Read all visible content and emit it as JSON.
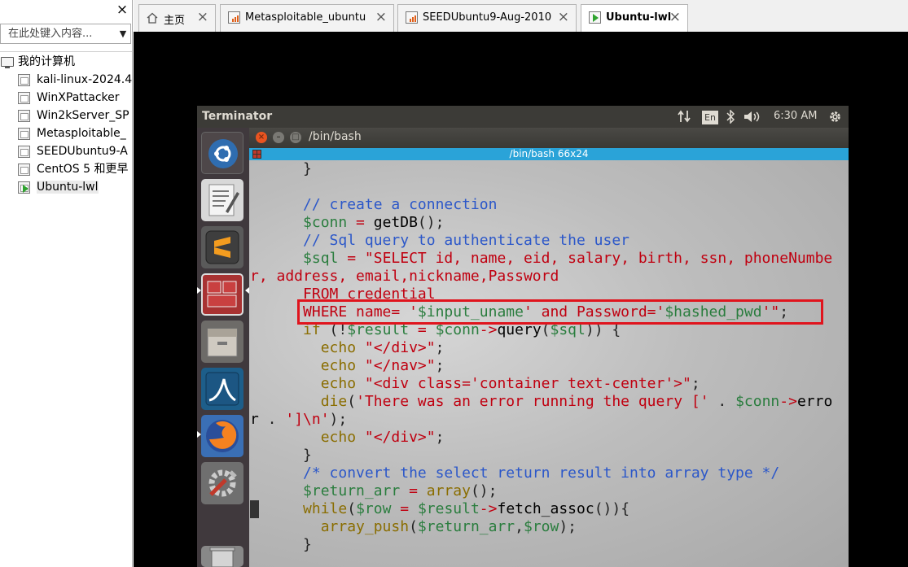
{
  "library": {
    "close_icon": "×",
    "search_placeholder": "在此处键入内容...",
    "dropdown_icon": "▼",
    "root": "我的计算机",
    "items": [
      {
        "label": "kali-linux-2024.4",
        "running": false
      },
      {
        "label": "WinXPattacker",
        "running": false
      },
      {
        "label": "Win2kServer_SP",
        "running": false
      },
      {
        "label": "Metasploitable_",
        "running": false
      },
      {
        "label": "SEEDUbuntu9-A",
        "running": false
      },
      {
        "label": "CentOS 5 和更早",
        "running": false
      },
      {
        "label": "Ubuntu-lwl",
        "running": true
      }
    ]
  },
  "tabs": [
    {
      "label": "主页",
      "icon": "home-icon"
    },
    {
      "label": "Metasploitable_ubuntu",
      "icon": "vm-icon"
    },
    {
      "label": "SEEDUbuntu9-Aug-2010",
      "icon": "vm-icon"
    },
    {
      "label": "Ubuntu-lwl",
      "icon": "vm-running-icon",
      "active": true
    }
  ],
  "tab_close": "×",
  "ubuntu_panel": {
    "app_title": "Terminator",
    "keyboard": "En",
    "time": "6:30 AM"
  },
  "terminal": {
    "window_title": "/bin/bash",
    "tab_title": "/bin/bash 66x24"
  },
  "code_lines": [
    [
      {
        "t": "      }",
        "c": "c-plain"
      }
    ],
    [],
    [
      {
        "t": "      // create a connection",
        "c": "c-cmt"
      }
    ],
    [
      {
        "t": "      $conn",
        "c": "c-var"
      },
      {
        "t": " = ",
        "c": "c-op"
      },
      {
        "t": "getDB",
        "c": "c-fn"
      },
      {
        "t": "();",
        "c": "c-plain"
      }
    ],
    [
      {
        "t": "      // Sql query to authenticate the user",
        "c": "c-cmt"
      }
    ],
    [
      {
        "t": "      $sql",
        "c": "c-var"
      },
      {
        "t": " = ",
        "c": "c-op"
      },
      {
        "t": "\"SELECT id, name, eid, salary, birth, ssn, phoneNumbe",
        "c": "c-str"
      }
    ],
    [
      {
        "t": "r, address, email,nickname,Password",
        "c": "c-str"
      }
    ],
    [
      {
        "t": "      FROM credential",
        "c": "c-str"
      }
    ],
    [
      {
        "t": "      WHERE name= '",
        "c": "c-str"
      },
      {
        "t": "$input_uname",
        "c": "c-var"
      },
      {
        "t": "' and Password='",
        "c": "c-str"
      },
      {
        "t": "$hashed_pwd",
        "c": "c-var"
      },
      {
        "t": "'\"",
        "c": "c-str"
      },
      {
        "t": ";",
        "c": "c-plain"
      }
    ],
    [
      {
        "t": "      if",
        "c": "c-kw"
      },
      {
        "t": " (!",
        "c": "c-plain"
      },
      {
        "t": "$result",
        "c": "c-var"
      },
      {
        "t": " = ",
        "c": "c-op"
      },
      {
        "t": "$conn",
        "c": "c-var"
      },
      {
        "t": "->",
        "c": "c-op"
      },
      {
        "t": "query",
        "c": "c-fn"
      },
      {
        "t": "(",
        "c": "c-plain"
      },
      {
        "t": "$sql",
        "c": "c-var"
      },
      {
        "t": ")) {",
        "c": "c-plain"
      }
    ],
    [
      {
        "t": "        echo",
        "c": "c-kw"
      },
      {
        "t": " \"</div>\"",
        "c": "c-str"
      },
      {
        "t": ";",
        "c": "c-plain"
      }
    ],
    [
      {
        "t": "        echo",
        "c": "c-kw"
      },
      {
        "t": " \"</nav>\"",
        "c": "c-str"
      },
      {
        "t": ";",
        "c": "c-plain"
      }
    ],
    [
      {
        "t": "        echo",
        "c": "c-kw"
      },
      {
        "t": " \"<div class='container text-center'>\"",
        "c": "c-str"
      },
      {
        "t": ";",
        "c": "c-plain"
      }
    ],
    [
      {
        "t": "        die",
        "c": "c-kw"
      },
      {
        "t": "(",
        "c": "c-plain"
      },
      {
        "t": "'There was an error running the query ['",
        "c": "c-str"
      },
      {
        "t": " . ",
        "c": "c-plain"
      },
      {
        "t": "$conn",
        "c": "c-var"
      },
      {
        "t": "->",
        "c": "c-op"
      },
      {
        "t": "erro",
        "c": "c-fn"
      }
    ],
    [
      {
        "t": "r",
        "c": "c-fn"
      },
      {
        "t": " . ",
        "c": "c-plain"
      },
      {
        "t": "']\\n'",
        "c": "c-str"
      },
      {
        "t": ");",
        "c": "c-plain"
      }
    ],
    [
      {
        "t": "        echo",
        "c": "c-kw"
      },
      {
        "t": " \"</div>\"",
        "c": "c-str"
      },
      {
        "t": ";",
        "c": "c-plain"
      }
    ],
    [
      {
        "t": "      }",
        "c": "c-plain"
      }
    ],
    [
      {
        "t": "      /* convert the select return result into array type */",
        "c": "c-cmt"
      }
    ],
    [
      {
        "t": "      $return_arr",
        "c": "c-var"
      },
      {
        "t": " = ",
        "c": "c-op"
      },
      {
        "t": "array",
        "c": "c-kw"
      },
      {
        "t": "();",
        "c": "c-plain"
      }
    ],
    [
      {
        "t": "      while",
        "c": "c-kw"
      },
      {
        "t": "(",
        "c": "c-plain"
      },
      {
        "t": "$row",
        "c": "c-var"
      },
      {
        "t": " = ",
        "c": "c-op"
      },
      {
        "t": "$result",
        "c": "c-var"
      },
      {
        "t": "->",
        "c": "c-op"
      },
      {
        "t": "fetch_assoc",
        "c": "c-fn"
      },
      {
        "t": "()){",
        "c": "c-plain"
      }
    ],
    [
      {
        "t": "        array_push",
        "c": "c-kw"
      },
      {
        "t": "(",
        "c": "c-plain"
      },
      {
        "t": "$return_arr",
        "c": "c-var"
      },
      {
        "t": ",",
        "c": "c-plain"
      },
      {
        "t": "$row",
        "c": "c-var"
      },
      {
        "t": ");",
        "c": "c-plain"
      }
    ],
    [
      {
        "t": "      }",
        "c": "c-plain"
      }
    ]
  ],
  "colors": {
    "highlight_box": "#e0141d",
    "tab_bar": "#2aa3d8",
    "launcher_bg": "#40393d",
    "panel_bg": "#3c3b37"
  }
}
